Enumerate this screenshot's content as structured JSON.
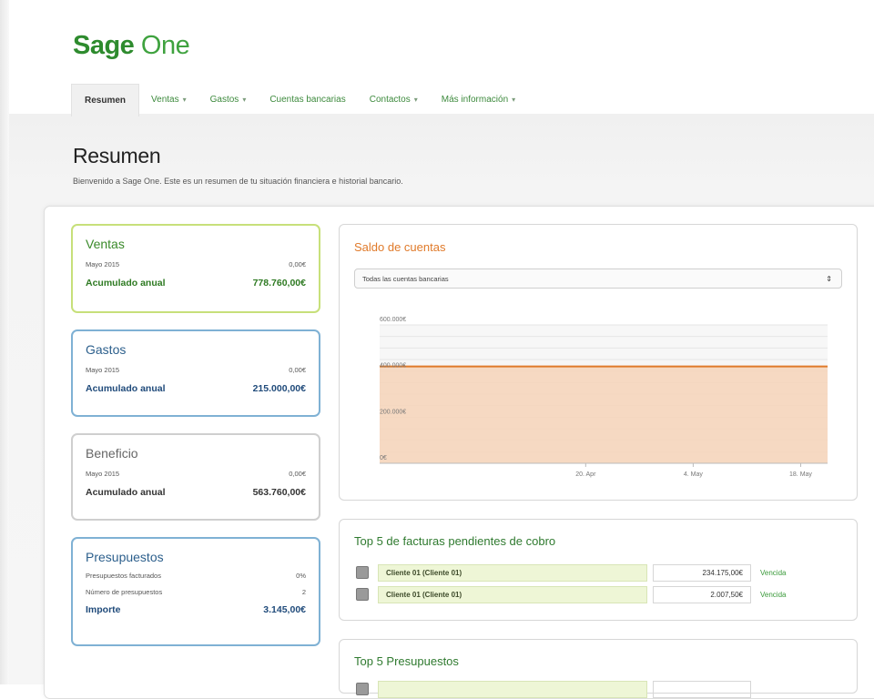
{
  "app": {
    "logo_sage": "Sage",
    "logo_one": "One"
  },
  "nav": [
    {
      "label": "Resumen",
      "active": true,
      "caret": false
    },
    {
      "label": "Ventas",
      "active": false,
      "caret": true
    },
    {
      "label": "Gastos",
      "active": false,
      "caret": true
    },
    {
      "label": "Cuentas bancarias",
      "active": false,
      "caret": false
    },
    {
      "label": "Contactos",
      "active": false,
      "caret": true
    },
    {
      "label": "Más información",
      "active": false,
      "caret": true
    }
  ],
  "page": {
    "title": "Resumen",
    "subtitle": "Bienvenido a Sage One. Este es un resumen de tu situación financiera e historial bancario."
  },
  "cards": {
    "ventas": {
      "title": "Ventas",
      "period_label": "Mayo 2015",
      "period_value": "0,00€",
      "total_label": "Acumulado anual",
      "total_value": "778.760,00€"
    },
    "gastos": {
      "title": "Gastos",
      "period_label": "Mayo 2015",
      "period_value": "0,00€",
      "total_label": "Acumulado anual",
      "total_value": "215.000,00€"
    },
    "beneficio": {
      "title": "Beneficio",
      "period_label": "Mayo 2015",
      "period_value": "0,00€",
      "total_label": "Acumulado anual",
      "total_value": "563.760,00€"
    },
    "presupuestos": {
      "title": "Presupuestos",
      "row1_label": "Presupuestos facturados",
      "row1_value": "0%",
      "row2_label": "Número de presupuestos",
      "row2_value": "2",
      "total_label": "Importe",
      "total_value": "3.145,00€"
    }
  },
  "saldo": {
    "title": "Saldo de cuentas",
    "select_value": "Todas las cuentas bancarias",
    "select_arrow": "⇕"
  },
  "chart_data": {
    "type": "area",
    "title": "",
    "xlabel": "",
    "ylabel": "",
    "ylim": [
      0,
      600000
    ],
    "y_ticks": [
      0,
      200000,
      400000,
      600000
    ],
    "y_tick_labels": [
      "0€",
      "200.000€",
      "400.000€",
      "600.000€"
    ],
    "x_tick_labels": [
      "20. Apr",
      "4. May",
      "18. May"
    ],
    "series": [
      {
        "values": [
          420000,
          420000,
          420000,
          420000,
          420000,
          420000,
          420000
        ]
      }
    ],
    "grid": true,
    "legend": "none",
    "colors": {
      "line": "#e07a2a",
      "fill": "#f6d3b8"
    }
  },
  "top_facturas": {
    "title": "Top 5 de facturas pendientes de cobro",
    "rows": [
      {
        "client": "Cliente 01 (Cliente 01)",
        "amount": "234.175,00€",
        "status": "Vencida"
      },
      {
        "client": "Cliente 01 (Cliente 01)",
        "amount": "2.007,50€",
        "status": "Vencida"
      }
    ]
  },
  "top_presupuestos": {
    "title": "Top 5 Presupuestos"
  },
  "colors": {
    "brand_green": "#2e8b2e",
    "ventas_border": "#c7e07a",
    "gastos_border": "#7fb1d4",
    "chart_orange": "#e07a2a"
  }
}
